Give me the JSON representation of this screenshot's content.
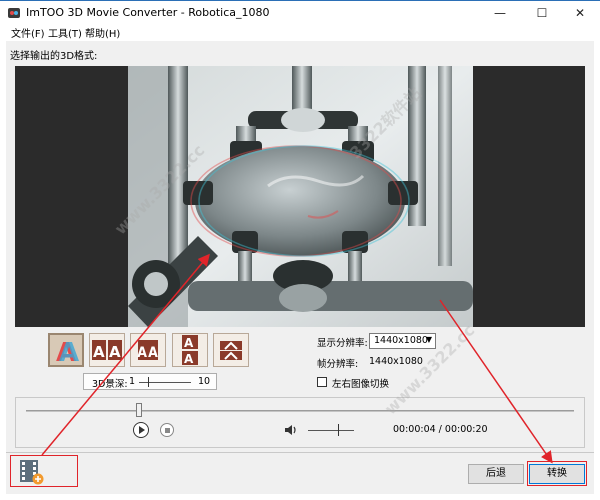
{
  "window": {
    "title": "ImTOO 3D Movie Converter - Robotica_1080",
    "minimize_glyph": "—",
    "maximize_glyph": "☐",
    "close_glyph": "✕"
  },
  "menu": [
    {
      "label": "文件(F)"
    },
    {
      "label": "工具(T)"
    },
    {
      "label": "帮助(H)"
    }
  ],
  "section_label": "选择输出的3D格式:",
  "format_buttons": [
    {
      "icon": "anaglyph-a-icon",
      "selected": true
    },
    {
      "icon": "side-by-side-aa-icon",
      "selected": false
    },
    {
      "icon": "side-by-side-half-aa-icon",
      "selected": false
    },
    {
      "icon": "top-bottom-aa-icon",
      "selected": false
    },
    {
      "icon": "top-bottom-half-icon",
      "selected": false
    }
  ],
  "depth": {
    "label": "3D景深:",
    "min": "1",
    "max": "10",
    "value": 2
  },
  "display_resolution": {
    "label": "显示分辨率:",
    "value": "1440x1080"
  },
  "frame_resolution": {
    "label": "帧分辨率:",
    "value": "1440x1080"
  },
  "swap_lr": {
    "label": "左右图像切换",
    "checked": false
  },
  "player": {
    "progress": 0.2,
    "time": "00:00:04 / 00:00:20",
    "volume": 0.65
  },
  "buttons": {
    "back": "后退",
    "convert": "转换"
  },
  "watermarks": [
    "www.3322.cc",
    "3322软件站"
  ],
  "colors": {
    "annotation": "#e0242a",
    "accent": "#0078d7",
    "selected_format": "#d8c9b6"
  }
}
